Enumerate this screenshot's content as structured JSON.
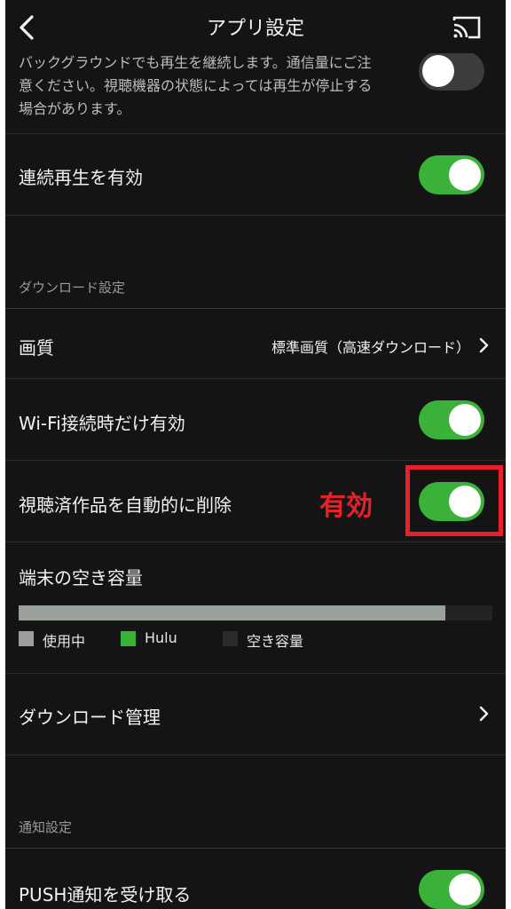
{
  "header": {
    "title": "アプリ設定"
  },
  "background_playback": {
    "description_lines": [
      "バックグラウンドでも再生を継続します。通信量にご注",
      "意ください。視聴機器の状態によっては再生が停止する",
      "場合があります。"
    ],
    "enabled": false
  },
  "continuous_play": {
    "label": "連続再生を有効",
    "enabled": true
  },
  "download_section": {
    "header": "ダウンロード設定",
    "quality": {
      "label": "画質",
      "value": "標準画質（高速ダウンロード）"
    },
    "wifi_only": {
      "label": "Wi-Fi接続時だけ有効",
      "enabled": true
    },
    "auto_delete": {
      "label": "視聴済作品を自動的に削除",
      "enabled": true
    },
    "storage": {
      "label": "端末の空き容量",
      "used_fraction": 0.9,
      "legend": [
        {
          "label": "使用中",
          "color": "#9aa09a"
        },
        {
          "label": "Hulu",
          "color": "#3ab23a"
        },
        {
          "label": "空き容量",
          "color": "#2a2a2a"
        }
      ]
    },
    "manage": {
      "label": "ダウンロード管理"
    }
  },
  "notification_section": {
    "header": "通知設定",
    "push": {
      "label": "PUSH通知を受け取る",
      "enabled": true
    }
  },
  "annotation": {
    "text": "有効",
    "color": "#e8202a"
  },
  "colors": {
    "accent": "#3ab23a",
    "background": "#141414"
  }
}
